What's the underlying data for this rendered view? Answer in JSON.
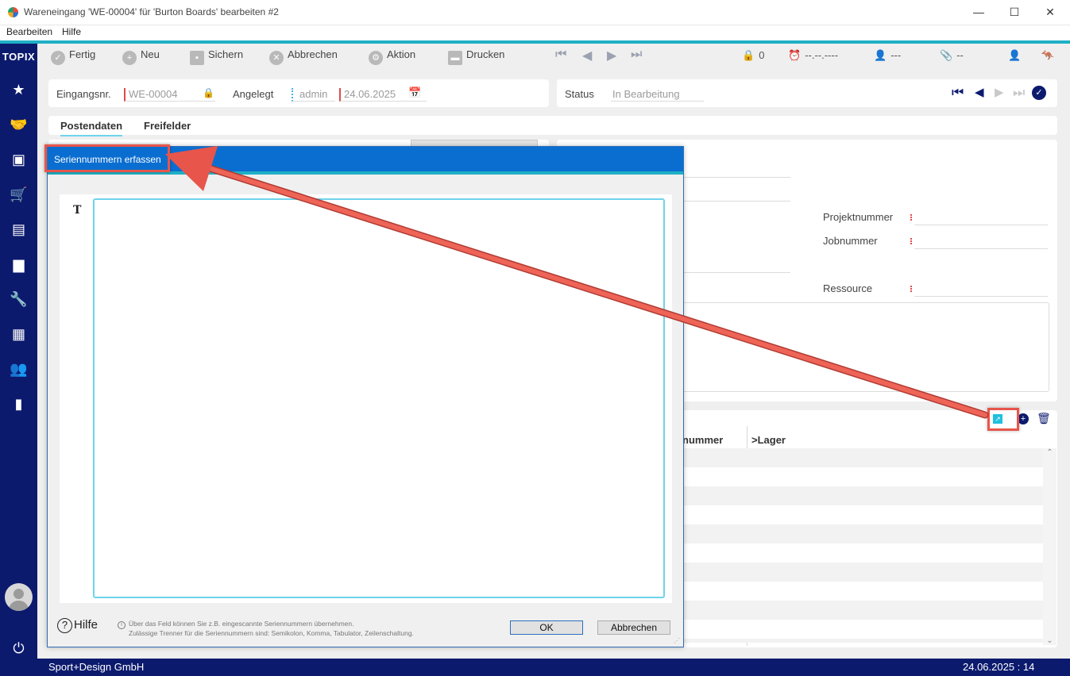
{
  "window": {
    "title": "Wareneingang 'WE-00004' für 'Burton Boards' bearbeiten #2",
    "controls": {
      "minimize": "—",
      "maximize": "☐",
      "close": "✕"
    }
  },
  "menu": [
    "Bearbeiten",
    "Hilfe"
  ],
  "sidebar": {
    "brand": "TOPIX",
    "icons": [
      "star-icon",
      "handshake-icon",
      "money-icon",
      "cart-icon",
      "warehouse-icon",
      "box-icon",
      "wrench-icon",
      "calculator-icon",
      "people-icon",
      "chart-icon"
    ]
  },
  "toolbar": {
    "fertig": "Fertig",
    "neu": "Neu",
    "sichern": "Sichern",
    "abbrechen": "Abbrechen",
    "aktion": "Aktion",
    "drucken": "Drucken",
    "locks": "0",
    "reminder": "--.--.----",
    "user": "---",
    "attachment": "--"
  },
  "header": {
    "eingangsnr_label": "Eingangsnr.",
    "eingangsnr_value": "WE-00004",
    "angelegt_label": "Angelegt",
    "angelegt_user": "admin",
    "angelegt_date": "24.06.2025",
    "status_label": "Status",
    "status_value": "In Bearbeitung"
  },
  "tabs": [
    "Postendaten",
    "Freifelder"
  ],
  "right_panel": {
    "projektnummer_label": "Projektnummer",
    "jobnummer_label": "Jobnummer",
    "ressource_label": "Ressource"
  },
  "grid": {
    "col_nummer": "nummer",
    "col_lager": ">Lager"
  },
  "statusbar": {
    "company": "Sport+Design GmbH",
    "date": "24.06.2025 : 14"
  },
  "dialog": {
    "title": "Seriennummern erfassen",
    "input_value": "",
    "help": "Hilfe",
    "hint_line1": "Über das Feld können Sie z.B. eingescannte Seriennummern übernehmen.",
    "hint_line2": "Zulässige Trenner für die Seriennummern sind: Semikolon, Komma, Tabulator, Zeilenschaltung.",
    "ok": "OK",
    "cancel": "Abbrechen"
  },
  "colors": {
    "sidebar": "#0c1a6e",
    "accent": "#1fb0c6",
    "dialog_header": "#0a6ed1",
    "annotation": "#e8554a"
  }
}
